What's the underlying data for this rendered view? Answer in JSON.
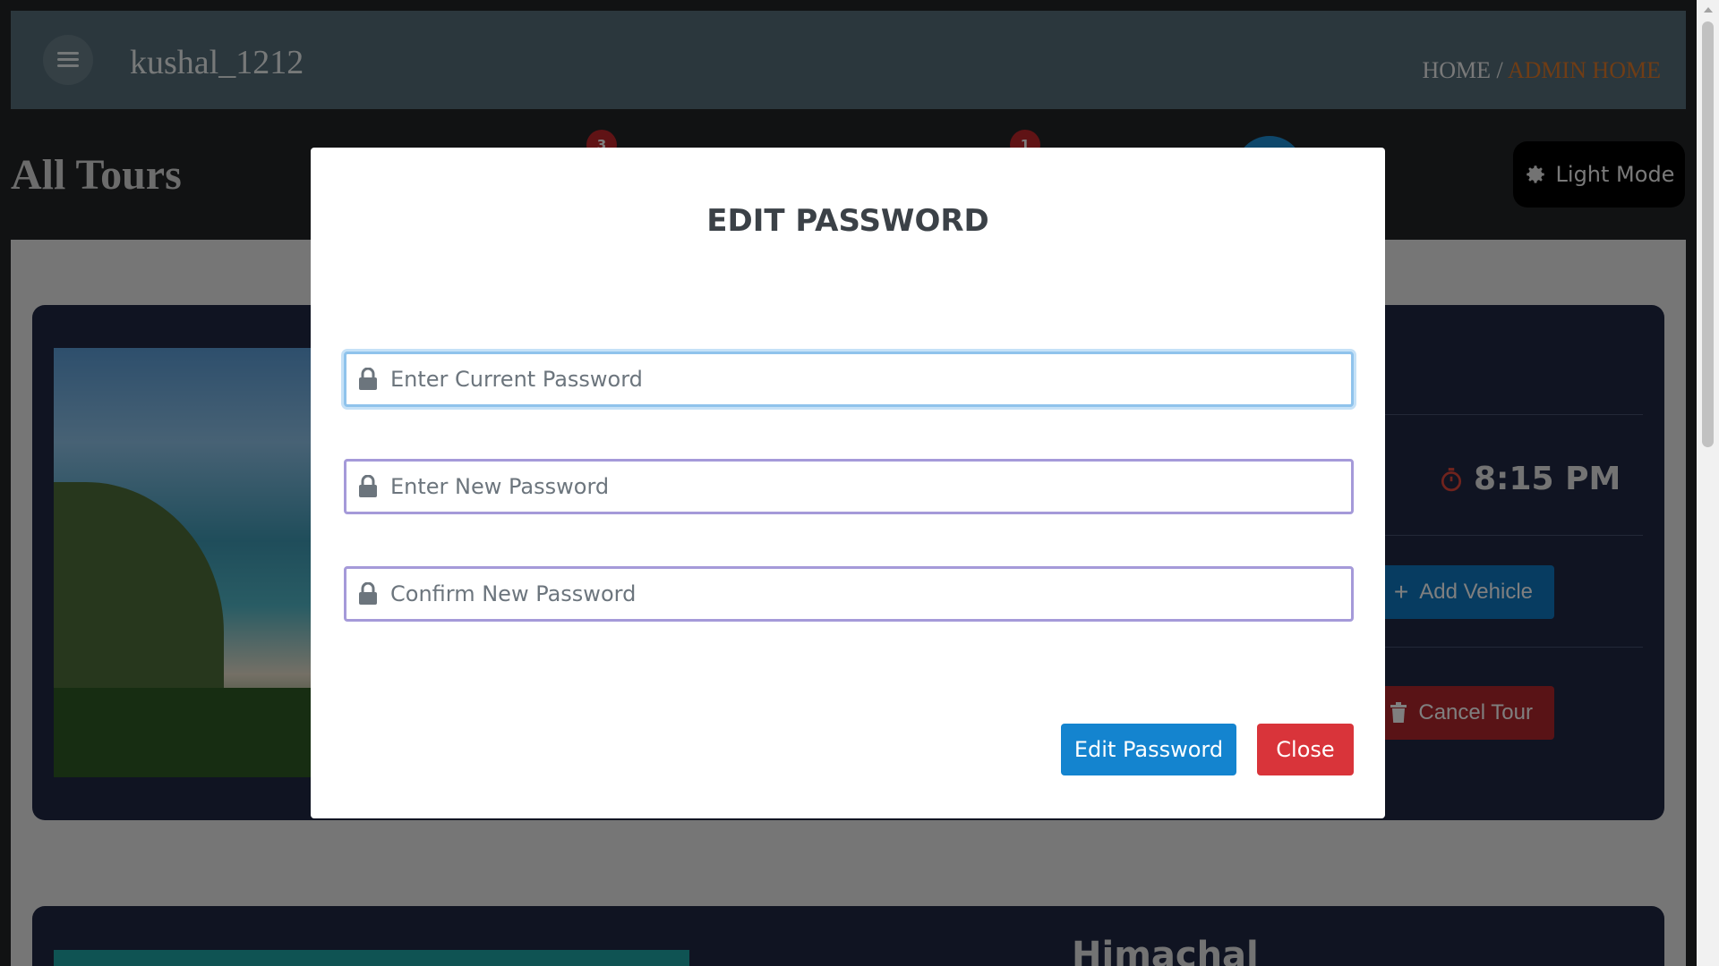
{
  "header": {
    "username": "kushal_1212",
    "breadcrumb": {
      "home": "HOME",
      "separator": " / ",
      "current": "ADMIN HOME"
    },
    "menu_icon": "hamburger-menu-icon"
  },
  "page": {
    "title": "All Tours",
    "badges": [
      "3",
      "1"
    ],
    "theme_toggle_label": "Light Mode",
    "theme_icon": "gear-icon"
  },
  "tours": [
    {
      "time": "8:15 PM",
      "add_vehicle_label": "Add Vehicle",
      "cancel_label": "Cancel Tour"
    },
    {
      "name": "Himachal"
    }
  ],
  "modal": {
    "title": "EDIT PASSWORD",
    "fields": [
      {
        "placeholder": "Enter Current Password",
        "value": ""
      },
      {
        "placeholder": "Enter New Password",
        "value": ""
      },
      {
        "placeholder": "Confirm New Password",
        "value": ""
      }
    ],
    "submit_label": "Edit Password",
    "close_label": "Close"
  },
  "colors": {
    "accent_blue": "#1484cf",
    "danger_red": "#d9343a",
    "breadcrumb_active": "#e07a2a",
    "header_bg": "#566f7b"
  }
}
